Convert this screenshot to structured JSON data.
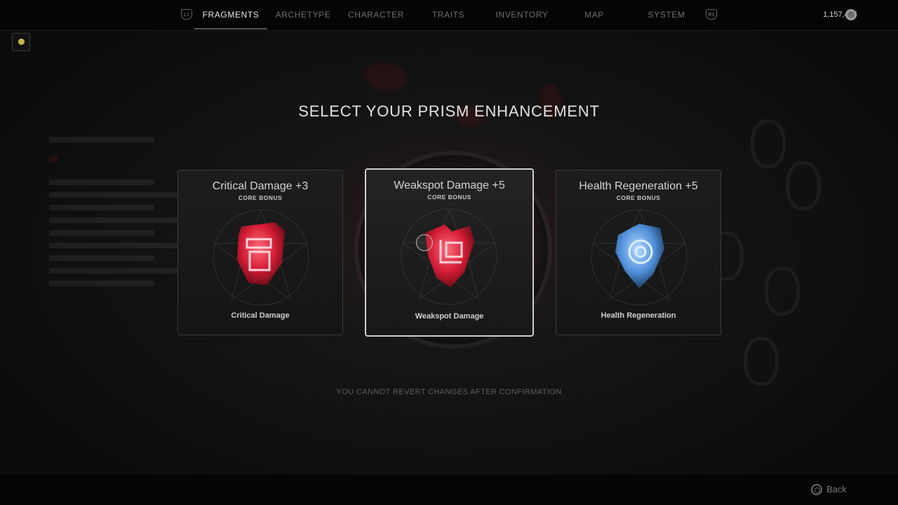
{
  "nav": {
    "left_bumper": "L1",
    "right_bumper": "R1",
    "tabs": [
      {
        "label": "FRAGMENTS",
        "active": true
      },
      {
        "label": "ARCHETYPE",
        "active": false
      },
      {
        "label": "CHARACTER",
        "active": false
      },
      {
        "label": "TRAITS",
        "active": false
      },
      {
        "label": "INVENTORY",
        "active": false
      },
      {
        "label": "MAP",
        "active": false
      },
      {
        "label": "SYSTEM",
        "active": false
      }
    ],
    "currency": "1,157,464",
    "currency_icon": "scrap-currency-icon"
  },
  "heading": "SELECT YOUR PRISM ENHANCEMENT",
  "cards": [
    {
      "title": "Critical Damage +3",
      "subtitle": "CORE BONUS",
      "label": "Critical Damage",
      "gem_color": "#d21c35",
      "icon": "critical-damage-gem-icon",
      "selected": false
    },
    {
      "title": "Weakspot Damage +5",
      "subtitle": "CORE BONUS",
      "label": "Weakspot Damage",
      "gem_color": "#d21c35",
      "icon": "weakspot-damage-gem-icon",
      "selected": true
    },
    {
      "title": "Health Regeneration +5",
      "subtitle": "CORE BONUS",
      "label": "Health Regeneration",
      "gem_color": "#4f8ed8",
      "icon": "health-regeneration-gem-icon",
      "selected": false
    }
  ],
  "warning": "YOU CANNOT REVERT CHANGES AFTER CONFIRMATION",
  "footer": {
    "back_label": "Back",
    "back_icon": "circle-button-icon"
  }
}
